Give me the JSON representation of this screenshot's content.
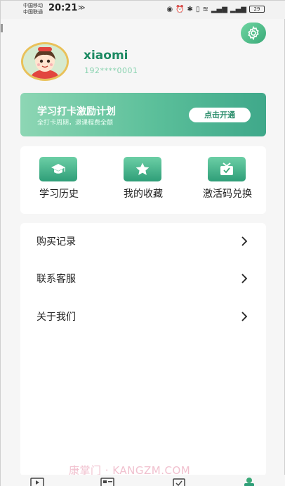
{
  "status_bar": {
    "carrier_1": "中国移动",
    "carrier_2": "中国联通",
    "time": "20:21",
    "battery": "29"
  },
  "profile": {
    "username": "xiaomi",
    "phone": "192****0001"
  },
  "banner": {
    "title": "学习打卡激励计划",
    "subtitle": "全打卡周期，退课程费全额",
    "button": "点击开通"
  },
  "quick_actions": [
    {
      "label": "学习历史",
      "icon": "graduation-cap-icon"
    },
    {
      "label": "我的收藏",
      "icon": "star-icon"
    },
    {
      "label": "激活码兑换",
      "icon": "gift-icon"
    }
  ],
  "menu": [
    {
      "label": "购买记录"
    },
    {
      "label": "联系客服"
    },
    {
      "label": "关于我们"
    }
  ],
  "bottom_nav": [
    {
      "icon": "video-icon"
    },
    {
      "icon": "card-icon"
    },
    {
      "icon": "calendar-check-icon"
    },
    {
      "icon": "profile-icon",
      "active": true
    }
  ],
  "watermark": "康掌门 · KANGZM.COM",
  "colors": {
    "accent": "#3aa978",
    "accent_light": "#8dd6b4",
    "username": "#1d8a63"
  }
}
